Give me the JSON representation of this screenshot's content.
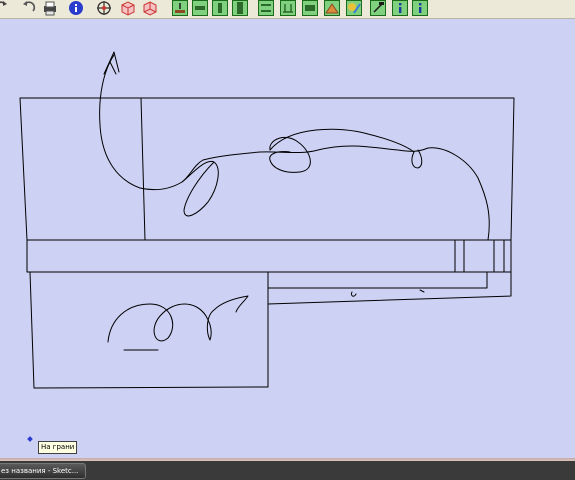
{
  "toolbar": {
    "buttons": [
      {
        "name": "redo-icon"
      },
      {
        "name": "print-icon"
      },
      {
        "name": "model-info-icon"
      },
      {
        "name": "orbit-icon"
      },
      {
        "name": "front-view-icon"
      },
      {
        "name": "back-view-icon"
      },
      {
        "name": "section-tool-icon-1"
      },
      {
        "name": "section-tool-icon-2"
      },
      {
        "name": "section-tool-icon-3"
      },
      {
        "name": "section-tool-icon-4"
      },
      {
        "name": "section-tool-icon-5"
      },
      {
        "name": "section-tool-icon-6"
      },
      {
        "name": "section-tool-icon-7"
      },
      {
        "name": "section-tool-icon-8"
      },
      {
        "name": "section-tool-icon-9"
      },
      {
        "name": "section-tool-icon-10"
      },
      {
        "name": "info-icon-1"
      },
      {
        "name": "info-icon-2"
      }
    ]
  },
  "canvas": {
    "background": "#cdd1f3",
    "stroke": "#000000",
    "inference_color": "#2a3bd1"
  },
  "tooltip": {
    "text": "На грани"
  },
  "taskbar": {
    "task_title": "ез названия - Sketc..."
  }
}
